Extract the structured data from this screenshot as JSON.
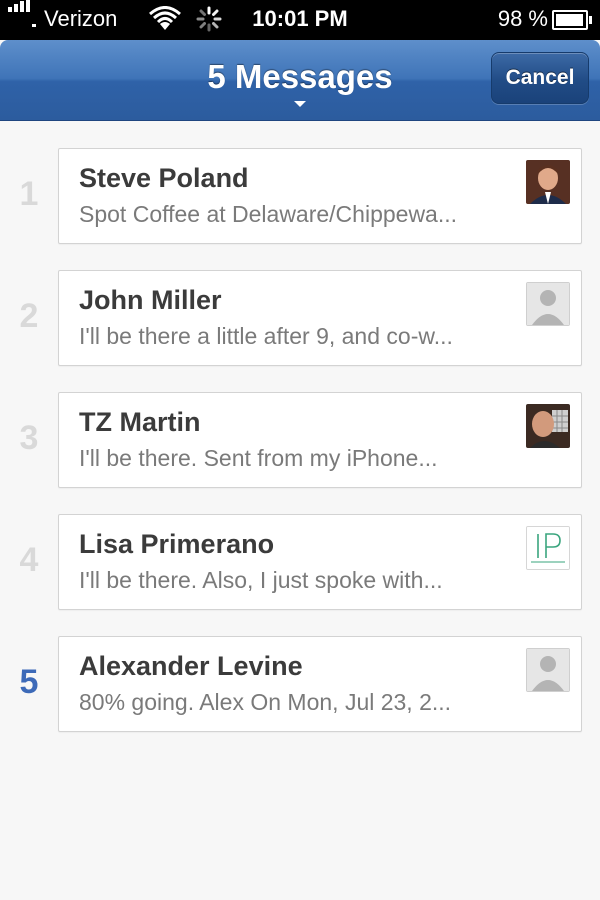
{
  "status_bar": {
    "carrier": "Verizon",
    "time": "10:01 PM",
    "battery": "98 %",
    "icons": [
      "signal-bars-icon",
      "wifi-icon",
      "activity-spinner-icon",
      "battery-icon"
    ]
  },
  "nav": {
    "title": "5 Messages",
    "cancel_label": "Cancel",
    "bar_color": "#3f74b8"
  },
  "messages": [
    {
      "number": "1",
      "name": "Steve Poland",
      "preview": "Spot Coffee at Delaware/Chippewa...",
      "avatar": "photo-avatar"
    },
    {
      "number": "2",
      "name": "John Miller",
      "preview": "I'll be there a little after 9, and co-w...",
      "avatar": "default-avatar-icon"
    },
    {
      "number": "3",
      "name": "TZ Martin",
      "preview": "I'll be there. Sent from my iPhone...",
      "avatar": "photo-avatar"
    },
    {
      "number": "4",
      "name": "Lisa Primerano",
      "preview": "I'll be there. Also, I just spoke with...",
      "avatar": "ip-logo-avatar"
    },
    {
      "number": "5",
      "name": "Alexander Levine",
      "preview": "80% going. Alex On Mon, Jul 23, 2...",
      "avatar": "default-avatar-icon"
    }
  ],
  "colors": {
    "active_number": "#3d6ab8",
    "inactive_number": "#d9d9d9",
    "background": "#f7f7f7"
  }
}
